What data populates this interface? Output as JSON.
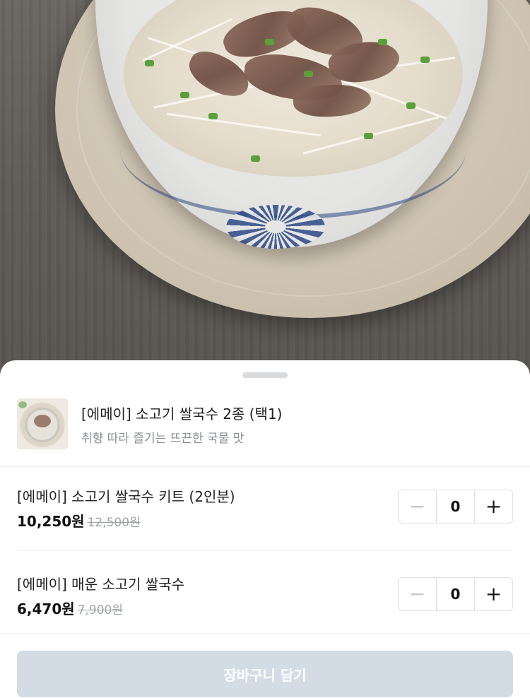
{
  "product": {
    "title": "[에메이] 소고기 쌀국수 2종 (택1)",
    "subtitle": "취향 따라 즐기는 뜨끈한 국물 맛"
  },
  "options": [
    {
      "name": "[에메이] 소고기 쌀국수 키트 (2인분)",
      "price": "10,250원",
      "original_price": "12,500원",
      "quantity": "0"
    },
    {
      "name": "[에메이] 매운 소고기 쌀국수",
      "price": "6,470원",
      "original_price": "7,900원",
      "quantity": "0"
    }
  ],
  "stepper": {
    "minus_symbol": "−",
    "plus_symbol": "+"
  },
  "cart_button": {
    "label": "장바구니 담기",
    "state": "disabled"
  },
  "colors": {
    "button_disabled": "#d3dce4",
    "text_primary": "#222222",
    "text_secondary": "#8a8d91",
    "strike_price": "#a0a3a7"
  }
}
